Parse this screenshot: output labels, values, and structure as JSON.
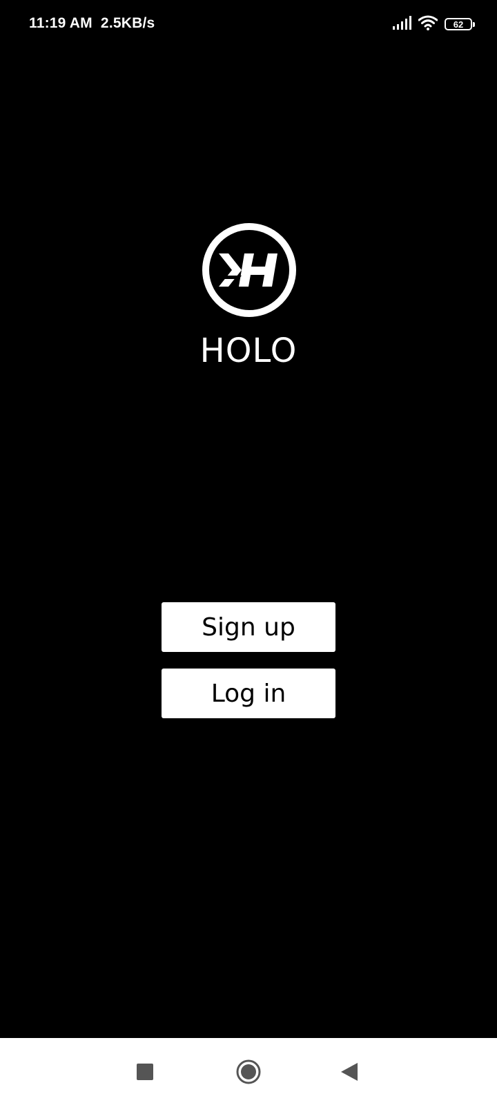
{
  "status_bar": {
    "time_speed": "11:19 AM  2.5KB/s",
    "battery_level": "62",
    "icons": [
      "signal-icon",
      "wifi-icon",
      "battery-icon"
    ]
  },
  "app": {
    "brand_name": "HOLO",
    "logo_icon": "holo-logo-icon"
  },
  "actions": {
    "signup_label": "Sign up",
    "login_label": "Log in"
  },
  "nav_bar": {
    "icons": [
      "recent-apps-icon",
      "home-icon",
      "back-icon"
    ]
  },
  "colors": {
    "background": "#000000",
    "foreground": "#ffffff",
    "button_text": "#000000",
    "nav_icon": "#555555"
  }
}
